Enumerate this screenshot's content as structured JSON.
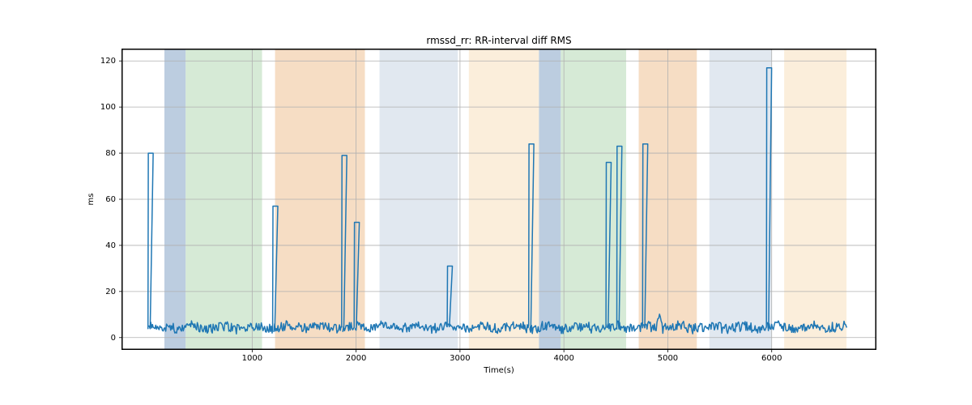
{
  "chart_data": {
    "type": "line",
    "title": "rmssd_rr: RR-interval diff RMS",
    "xlabel": "Time(s)",
    "ylabel": "ms",
    "xlim": [
      -250,
      7000
    ],
    "ylim": [
      -5,
      125
    ],
    "xticks": [
      1000,
      2000,
      3000,
      4000,
      5000,
      6000
    ],
    "yticks": [
      0,
      20,
      40,
      60,
      80,
      100,
      120
    ],
    "bands": [
      {
        "x0": 155,
        "x1": 360,
        "color": "#bccde0"
      },
      {
        "x0": 360,
        "x1": 1095,
        "color": "#d6ead6"
      },
      {
        "x0": 1095,
        "x1": 1220,
        "color": "#ffffff"
      },
      {
        "x0": 1220,
        "x1": 2085,
        "color": "#f6ddc4"
      },
      {
        "x0": 2085,
        "x1": 2225,
        "color": "#ffffff"
      },
      {
        "x0": 2225,
        "x1": 2980,
        "color": "#e1e8f0"
      },
      {
        "x0": 2980,
        "x1": 3085,
        "color": "#ffffff"
      },
      {
        "x0": 3085,
        "x1": 3760,
        "color": "#fbeedb"
      },
      {
        "x0": 3760,
        "x1": 3970,
        "color": "#bccde0"
      },
      {
        "x0": 3970,
        "x1": 4600,
        "color": "#d6ead6"
      },
      {
        "x0": 4600,
        "x1": 4720,
        "color": "#ffffff"
      },
      {
        "x0": 4720,
        "x1": 5280,
        "color": "#f6ddc4"
      },
      {
        "x0": 5280,
        "x1": 5400,
        "color": "#ffffff"
      },
      {
        "x0": 5400,
        "x1": 6000,
        "color": "#e1e8f0"
      },
      {
        "x0": 6000,
        "x1": 6120,
        "color": "#ffffff"
      },
      {
        "x0": 6120,
        "x1": 6720,
        "color": "#fbeedb"
      }
    ],
    "spikes": [
      {
        "x": 1,
        "y": 80
      },
      {
        "x": 1200,
        "y": 57
      },
      {
        "x": 1860,
        "y": 79
      },
      {
        "x": 1980,
        "y": 50
      },
      {
        "x": 2880,
        "y": 31
      },
      {
        "x": 3660,
        "y": 84
      },
      {
        "x": 4405,
        "y": 76
      },
      {
        "x": 4510,
        "y": 83
      },
      {
        "x": 4760,
        "y": 84
      },
      {
        "x": 5955,
        "y": 117
      }
    ],
    "baseline_mean": 4.5,
    "baseline_noise": 2.0,
    "bump": {
      "x": 4920,
      "y": 10
    }
  },
  "layout": {
    "axes_left": 150,
    "axes_top": 60,
    "axes_width": 930,
    "axes_height": 370
  }
}
